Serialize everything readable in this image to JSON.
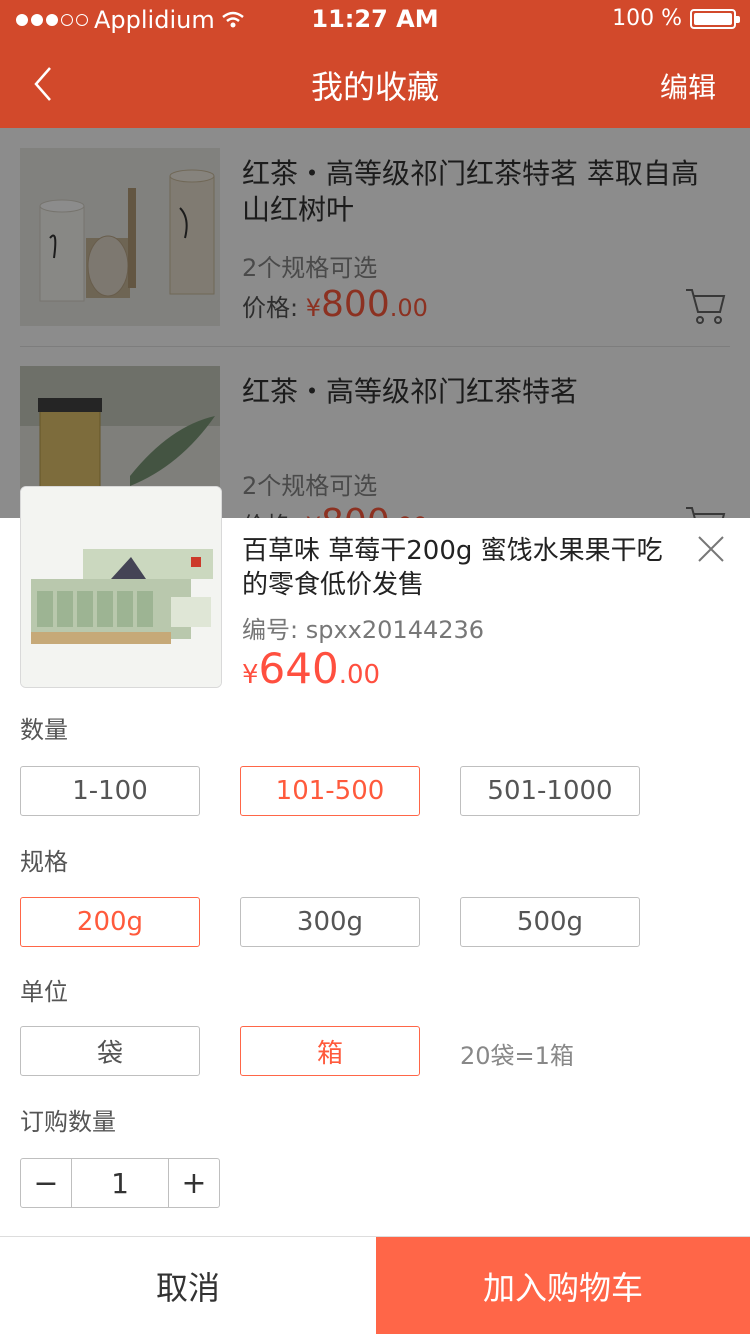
{
  "status_bar": {
    "carrier": "Applidium",
    "time": "11:27 AM",
    "battery": "100 %"
  },
  "nav": {
    "title": "我的收藏",
    "edit_label": "编辑"
  },
  "favorites": [
    {
      "name": "红茶・高等级祁门红茶特茗  萃取自高山红树叶",
      "spec_text": "2个规格可选",
      "price_label": "价格:",
      "currency": "¥",
      "price_int": "800",
      "price_dec": ".00"
    },
    {
      "name": "红茶・高等级祁门红茶特茗",
      "spec_text": "2个规格可选",
      "price_label": "价格:",
      "currency": "¥",
      "price_int": "800",
      "price_dec": ".00"
    }
  ],
  "product": {
    "name": "百草味  草莓干200g 蜜饯水果果干吃的零食低价发售",
    "code_label": "编号:",
    "code": "spxx20144236",
    "currency": "¥",
    "price_int": "640",
    "price_dec": ".00"
  },
  "quantity_range": {
    "label": "数量",
    "options": [
      "1-100",
      "101-500",
      "501-1000"
    ],
    "selected": "101-500"
  },
  "spec": {
    "label": "规格",
    "options": [
      "200g",
      "300g",
      "500g"
    ],
    "selected": "200g"
  },
  "unit": {
    "label": "单位",
    "options": [
      "袋",
      "箱"
    ],
    "selected": "箱",
    "note": "20袋=1箱"
  },
  "order_qty": {
    "label": "订购数量",
    "minus": "−",
    "value": "1",
    "plus": "+"
  },
  "footer": {
    "cancel_label": "取消",
    "add_label": "加入购物车"
  },
  "colors": {
    "brand": "#d2492b",
    "accent": "#ff6648",
    "price": "#ff4f3f"
  }
}
